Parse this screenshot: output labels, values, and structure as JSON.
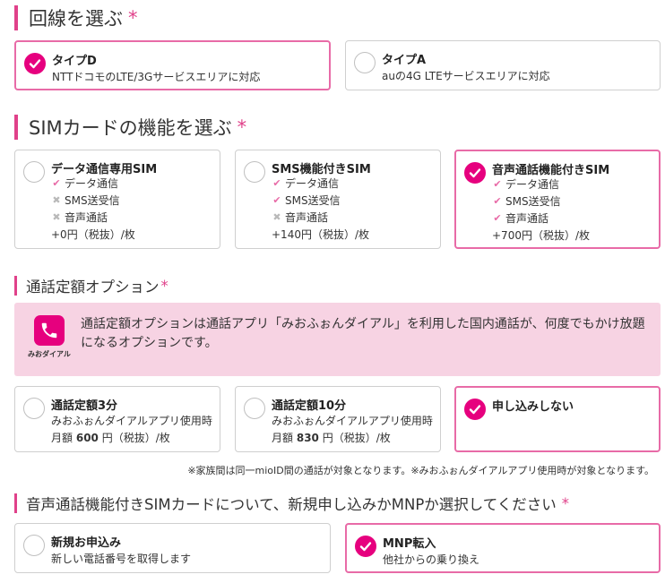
{
  "line_section": {
    "heading": "回線を選ぶ",
    "required": "*",
    "options": [
      {
        "title": "タイプD",
        "desc": "NTTドコモのLTE/3Gサービスエリアに対応",
        "selected": true
      },
      {
        "title": "タイプA",
        "desc": "auの4G LTEサービスエリアに対応",
        "selected": false
      }
    ]
  },
  "sim_section": {
    "heading": "SIMカードの機能を選ぶ",
    "required": "*",
    "options": [
      {
        "title": "データ通信専用SIM",
        "f1": "データ通信",
        "f2": "SMS送受信",
        "f3": "音声通話",
        "price": "+0円（税抜）/枚",
        "selected": false
      },
      {
        "title": "SMS機能付きSIM",
        "f1": "データ通信",
        "f2": "SMS送受信",
        "f3": "音声通話",
        "price": "+140円（税抜）/枚",
        "selected": false
      },
      {
        "title": "音声通話機能付きSIM",
        "f1": "データ通信",
        "f2": "SMS送受信",
        "f3": "音声通話",
        "price": "+700円（税抜）/枚",
        "selected": true
      }
    ]
  },
  "call_section": {
    "heading": "通話定額オプション",
    "required": "*",
    "app_name": "みおダイアル",
    "description": "通話定額オプションは通話アプリ「みおふぉんダイアル」を利用した国内通話が、何度でもかけ放題になるオプションです。",
    "options": [
      {
        "title": "通話定額3分",
        "line1": "みおふぉんダイアルアプリ使用時",
        "price_prefix": "月額",
        "price_value": "600",
        "price_suffix": "円（税抜）/枚",
        "selected": false
      },
      {
        "title": "通話定額10分",
        "line1": "みおふぉんダイアルアプリ使用時",
        "price_prefix": "月額",
        "price_value": "830",
        "price_suffix": "円（税抜）/枚",
        "selected": false
      },
      {
        "title": "申し込みしない",
        "selected": true
      }
    ],
    "note": "※家族間は同一mioID間の通話が対象となります。※みおふぉんダイアルアプリ使用時が対象となります。"
  },
  "mnp_section": {
    "heading": "音声通話機能付きSIMカードについて、新規申し込みかMNPか選択してください",
    "required": "*",
    "options": [
      {
        "title": "新規お申込み",
        "desc": "新しい電話番号を取得します",
        "selected": false
      },
      {
        "title": "MNP転入",
        "desc": "他社からの乗り換え",
        "selected": true
      }
    ]
  },
  "icons": {
    "selected": "check-icon",
    "phone": "phone-icon",
    "feature_on": "check-mark-icon",
    "feature_off": "cross-mark-icon"
  },
  "colors": {
    "accent": "#e6007e",
    "selected_border": "#e86ba7",
    "info_bg": "#f7d3e3"
  }
}
